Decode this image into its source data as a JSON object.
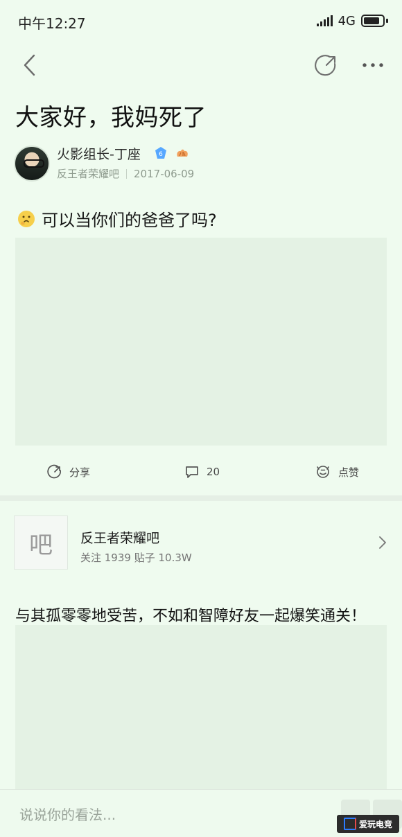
{
  "status_bar": {
    "time": "中午12:27",
    "network": "4G",
    "network_suffix": "ll"
  },
  "nav": {
    "back_icon": "chevron-left-icon",
    "share_icon": "share-arrow-icon",
    "more_icon": "ellipsis-icon"
  },
  "post": {
    "title": "大家好，我妈死了",
    "author": {
      "name": "火影组长-丁座",
      "badge_level": "6",
      "forum": "反王者荣耀吧",
      "date": "2017-06-09"
    },
    "body": "可以当你们的爸爸了吗?"
  },
  "actions": {
    "share_label": "分享",
    "comment_count": "20",
    "like_label": "点赞"
  },
  "forum_card": {
    "logo_char": "吧",
    "name": "反王者荣耀吧",
    "stats": "关注 1939   贴子 10.3W"
  },
  "promo_text": "与其孤零零地受苦，不如和智障好友一起爆笑通关！",
  "comment_bar": {
    "placeholder": "说说你的看法..."
  },
  "watermark": {
    "text": "爱玩电竞"
  },
  "colors": {
    "background": "#effbef",
    "image_placeholder": "#e4f2e4",
    "badge_blue": "#56a7ff",
    "muted_text": "#8d9a8d"
  }
}
